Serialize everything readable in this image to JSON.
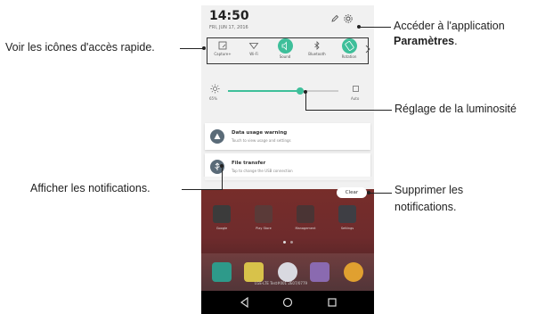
{
  "status": {
    "time": "14:50",
    "date": "FRI, JUN 17, 2016"
  },
  "quick_settings": [
    {
      "label": "Capture+",
      "icon": "capture-plus-icon"
    },
    {
      "label": "Wi-Fi",
      "icon": "wifi-icon"
    },
    {
      "label": "Sound",
      "icon": "sound-icon"
    },
    {
      "label": "Bluetooth",
      "icon": "bluetooth-icon"
    },
    {
      "label": "Rotation",
      "icon": "rotation-icon"
    }
  ],
  "brightness": {
    "percent_label": "65%",
    "value": 0.65,
    "auto_label": "Auto"
  },
  "notifications": [
    {
      "title": "Data usage warning",
      "subtitle": "Touch to view usage and settings",
      "icon": "warning-icon"
    },
    {
      "title": "File transfer",
      "subtitle": "Tap to change the USB connection",
      "icon": "usb-icon"
    }
  ],
  "clear_label": "Clear",
  "home": {
    "apps": [
      {
        "label": "Google",
        "color": "#3b3b3b"
      },
      {
        "label": "Play Store",
        "color": "#5a3a38"
      },
      {
        "label": "Management",
        "color": "#4a3434"
      },
      {
        "label": "Settings",
        "color": "#3e3e44"
      }
    ],
    "carrier": "LGE-LTE Test#001 2E07/0779"
  },
  "callouts": {
    "quick_access": "Voir les icônes d'accès rapide.",
    "settings_line1": "Accéder à l'application",
    "settings_line2": "Paramètres",
    "settings_suffix": ".",
    "brightness": "Réglage de la luminosité",
    "notifications": "Afficher les notifications.",
    "clear_line1": "Supprimer les",
    "clear_line2": "notifications."
  },
  "colors": {
    "accent": "#3ebf9a",
    "shade_bg": "#f1f1f1",
    "notif_icon": "#5a6b78"
  }
}
